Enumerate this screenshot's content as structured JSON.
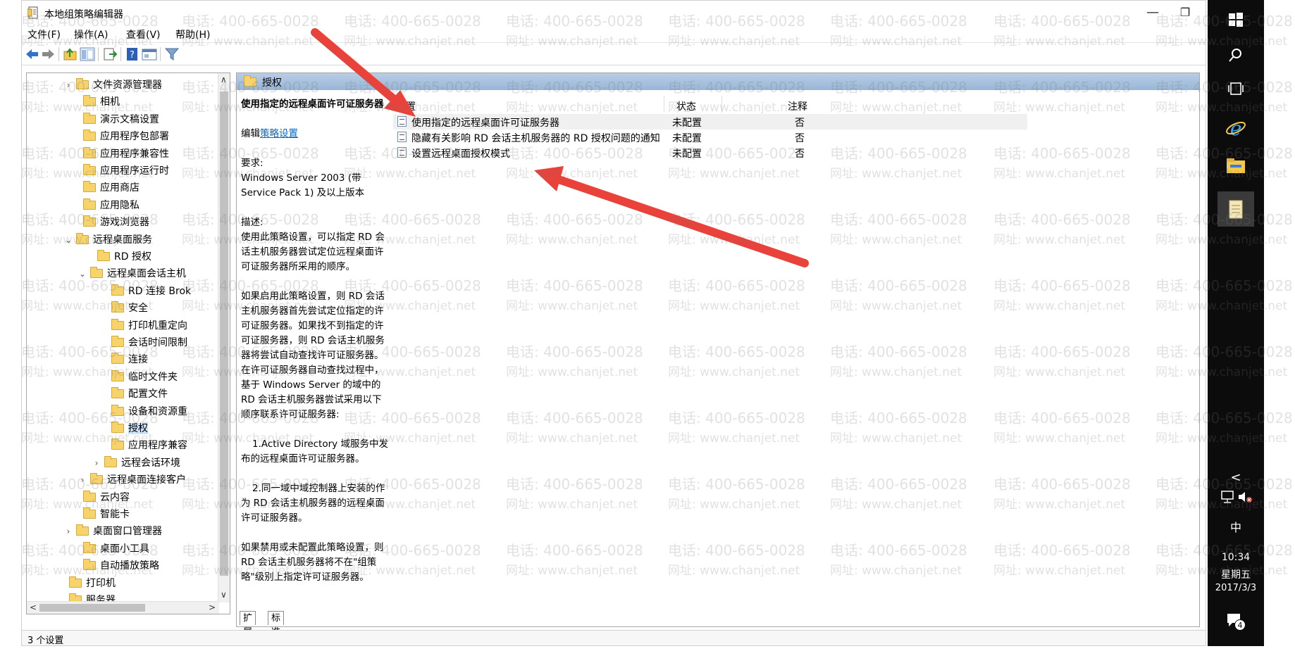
{
  "window": {
    "title": "本地组策略编辑器",
    "controls": {
      "minimize": "—",
      "restore": "❐",
      "close": "✕"
    }
  },
  "menu": [
    "文件(F)",
    "操作(A)",
    "查看(V)",
    "帮助(H)"
  ],
  "toolbar": {
    "icons": [
      "back-icon",
      "forward-icon",
      "up-folder-icon",
      "show-hide-tree-icon",
      "export-list-icon",
      "help-icon",
      "properties-icon",
      "filter-icon"
    ]
  },
  "tree": {
    "items": [
      {
        "label": "文件资源管理器",
        "expander": "›"
      },
      {
        "label": "相机",
        "expander": ""
      },
      {
        "label": "演示文稿设置",
        "expander": ""
      },
      {
        "label": "应用程序包部署",
        "expander": ""
      },
      {
        "label": "应用程序兼容性",
        "expander": ""
      },
      {
        "label": "应用程序运行时",
        "expander": ""
      },
      {
        "label": "应用商店",
        "expander": ""
      },
      {
        "label": "应用隐私",
        "expander": ""
      },
      {
        "label": "游戏浏览器",
        "expander": ""
      },
      {
        "label": "远程桌面服务",
        "expander": "⌄"
      },
      {
        "label": "RD 授权",
        "expander": ""
      },
      {
        "label": "远程桌面会话主机",
        "expander": "⌄"
      },
      {
        "label": "RD 连接 Brok",
        "expander": ""
      },
      {
        "label": "安全",
        "expander": ""
      },
      {
        "label": "打印机重定向",
        "expander": ""
      },
      {
        "label": "会话时间限制",
        "expander": ""
      },
      {
        "label": "连接",
        "expander": ""
      },
      {
        "label": "临时文件夹",
        "expander": ""
      },
      {
        "label": "配置文件",
        "expander": ""
      },
      {
        "label": "设备和资源重",
        "expander": ""
      },
      {
        "label": "授权",
        "expander": ""
      },
      {
        "label": "应用程序兼容",
        "expander": ""
      },
      {
        "label": "远程会话环境",
        "expander": "›"
      },
      {
        "label": "远程桌面连接客户",
        "expander": "›"
      },
      {
        "label": "云内容",
        "expander": ""
      },
      {
        "label": "智能卡",
        "expander": ""
      },
      {
        "label": "桌面窗口管理器",
        "expander": "›"
      },
      {
        "label": "桌面小工具",
        "expander": ""
      },
      {
        "label": "自动播放策略",
        "expander": ""
      },
      {
        "label": "打印机",
        "expander": ""
      },
      {
        "label": "服务器",
        "expander": ""
      }
    ],
    "selected_label": "授权"
  },
  "right_pane": {
    "header_title": "授权",
    "description": {
      "title": "使用指定的远程桌面许可证服务器",
      "edit_prefix": "编辑",
      "edit_link": "策略设置",
      "requirements_label": "要求:",
      "requirements": "Windows Server 2003 (带 Service Pack 1) 及以上版本",
      "desc_label": "描述:",
      "paragraphs": [
        "使用此策略设置，可以指定 RD 会话主机服务器尝试定位远程桌面许可证服务器所采用的顺序。",
        "如果启用此策略设置，则 RD 会话主机服务器首先尝试定位指定的许可证服务器。如果找不到指定的许可证服务器，则 RD 会话主机服务器将尝试自动查找许可证服务器。在许可证服务器自动查找过程中，基于 Windows Server 的域中的 RD 会话主机服务器尝试采用以下顺序联系许可证服务器:",
        "1.Active Directory 域服务中发布的远程桌面许可证服务器。",
        "2.同一域中域控制器上安装的作为 RD 会话主机服务器的远程桌面许可证服务器。",
        "如果禁用或未配置此策略设置，则 RD 会话主机服务器将不在\"组策略\"级别上指定许可证服务器。"
      ]
    },
    "columns": [
      "设置",
      "状态",
      "注释"
    ],
    "rows": [
      {
        "setting": "使用指定的远程桌面许可证服务器",
        "state": "未配置",
        "comment": "否"
      },
      {
        "setting": "隐藏有关影响 RD 会话主机服务器的 RD 授权问题的通知",
        "state": "未配置",
        "comment": "否"
      },
      {
        "setting": "设置远程桌面授权模式",
        "state": "未配置",
        "comment": "否"
      }
    ],
    "tabs": [
      "扩展",
      "标准"
    ]
  },
  "status_bar": "3 个设置",
  "taskbar": {
    "icons": [
      "windows-start-icon",
      "search-icon",
      "task-view-icon",
      "ie-browser-icon",
      "file-explorer-icon",
      "notepad-icon"
    ],
    "tray_chevron": "<",
    "ime": "中",
    "time": "10:34",
    "weekday": "星期五",
    "date": "2017/3/3",
    "notification_count": "4"
  },
  "watermark": {
    "phone": "电话: 400-665-0028",
    "site": "网址: www.chanjet.net"
  },
  "colors": {
    "arrow": "#e8423a",
    "header_gradient_top": "#b9cde5",
    "header_gradient_bottom": "#98b6d8",
    "link": "#0066cc",
    "taskbar": "#0c0c0c"
  }
}
